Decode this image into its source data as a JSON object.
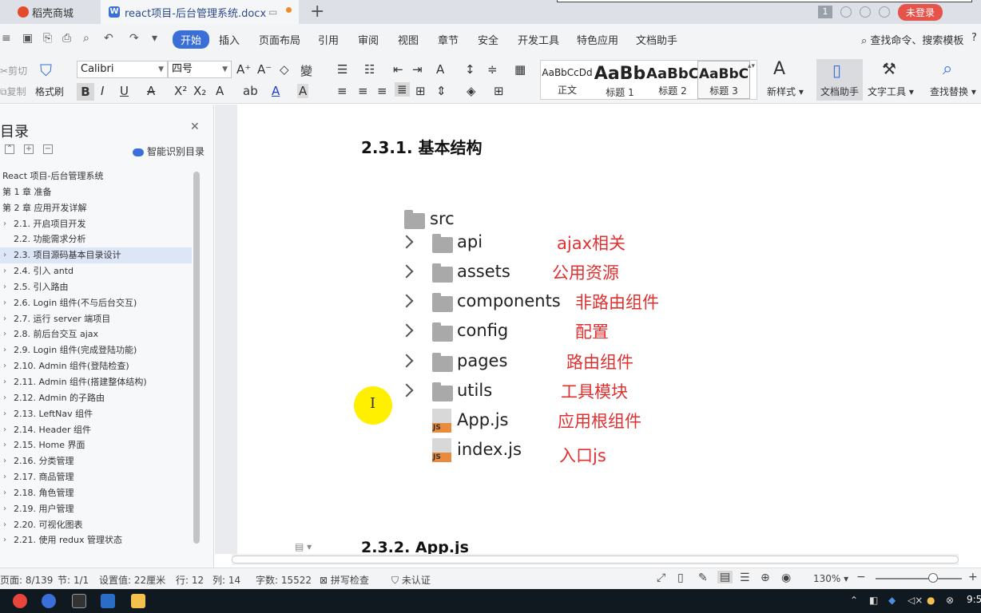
{
  "titlebar": {
    "tab_shop": "稻壳商城",
    "tab_doc": "react项目-后台管理系统.docx",
    "add_tab": "+",
    "badge": "1",
    "login": "未登录"
  },
  "menu": {
    "items": [
      "开始",
      "插入",
      "页面布局",
      "引用",
      "审阅",
      "视图",
      "章节",
      "安全",
      "开发工具",
      "特色应用",
      "文档助手"
    ],
    "search": "查找命令、搜索模板",
    "help": "?"
  },
  "ribbon": {
    "cut": "剪切",
    "copy": "复制",
    "format_painter": "格式刷",
    "font_name": "Calibri",
    "font_size": "四号",
    "styles": [
      {
        "preview": "AaBbCcDd",
        "name": "正文"
      },
      {
        "preview": "AaBb",
        "name": "标题 1"
      },
      {
        "preview": "AaBbC",
        "name": "标题 2"
      },
      {
        "preview": "AaBbC",
        "name": "标题 3"
      }
    ],
    "new_style": "新样式",
    "doc_helper": "文档助手",
    "text_tools": "文字工具",
    "find_replace": "查找替换"
  },
  "nav": {
    "title": "目录",
    "smart": "智能识别目录",
    "items": [
      {
        "text": "React 项目-后台管理系统",
        "level": 0
      },
      {
        "text": "第 1 章  准备",
        "level": 0
      },
      {
        "text": "第 2 章  应用开发详解",
        "level": 0
      },
      {
        "text": "2.1.  开启项目开发",
        "level": 1,
        "chev": true
      },
      {
        "text": "2.2.  功能需求分析",
        "level": 1
      },
      {
        "text": "2.3.  项目源码基本目录设计",
        "level": 1,
        "chev": true,
        "active": true
      },
      {
        "text": "2.4.  引入 antd",
        "level": 1,
        "chev": true
      },
      {
        "text": "2.5.  引入路由",
        "level": 1,
        "chev": true
      },
      {
        "text": "2.6. Login 组件(不与后台交互)",
        "level": 1,
        "chev": true
      },
      {
        "text": "2.7.  运行 server 端项目",
        "level": 1,
        "chev": true
      },
      {
        "text": "2.8.  前后台交互 ajax",
        "level": 1,
        "chev": true
      },
      {
        "text": "2.9. Login 组件(完成登陆功能)",
        "level": 1,
        "chev": true
      },
      {
        "text": "2.10. Admin 组件(登陆检查)",
        "level": 1,
        "chev": true
      },
      {
        "text": "2.11. Admin 组件(搭建整体结构)",
        "level": 1,
        "chev": true
      },
      {
        "text": "2.12. Admin 的子路由",
        "level": 1,
        "chev": true
      },
      {
        "text": "2.13. LeftNav 组件",
        "level": 1,
        "chev": true
      },
      {
        "text": "2.14. Header 组件",
        "level": 1,
        "chev": true
      },
      {
        "text": "2.15. Home 界面",
        "level": 1,
        "chev": true
      },
      {
        "text": "2.16.  分类管理",
        "level": 1,
        "chev": true
      },
      {
        "text": "2.17.  商品管理",
        "level": 1,
        "chev": true
      },
      {
        "text": "2.18.  角色管理",
        "level": 1,
        "chev": true
      },
      {
        "text": "2.19.  用户管理",
        "level": 1,
        "chev": true
      },
      {
        "text": "2.20.  可视化图表",
        "level": 1,
        "chev": true
      },
      {
        "text": "2.21.  使用 redux 管理状态",
        "level": 1,
        "chev": true
      }
    ]
  },
  "doc": {
    "heading1": "2.3.1.  基本结构",
    "heading2": "2.3.2. App.js",
    "root": "src",
    "tree": [
      {
        "name": "api",
        "kind": "folder",
        "note": "ajax相关"
      },
      {
        "name": "assets",
        "kind": "folder",
        "note": "公用资源"
      },
      {
        "name": "components",
        "kind": "folder",
        "note": "非路由组件"
      },
      {
        "name": "config",
        "kind": "folder",
        "note": "配置"
      },
      {
        "name": "pages",
        "kind": "folder",
        "note": "路由组件"
      },
      {
        "name": "utils",
        "kind": "folder",
        "note": "工具模块"
      },
      {
        "name": "App.js",
        "kind": "js",
        "note": "应用根组件"
      },
      {
        "name": "index.js",
        "kind": "js",
        "note": "入口js"
      }
    ],
    "js_badge": "JS"
  },
  "status": {
    "page": "页面: 8/139",
    "section": "节: 1/1",
    "setting": "设置值: 22厘米",
    "row": "行: 12",
    "col": "列: 14",
    "words": "字数: 15522",
    "spell": "拼写检查",
    "cert": "未认证",
    "zoom": "130%"
  },
  "taskbar": {
    "clock": "9:5"
  },
  "colors": {
    "accent": "#3b6fd8",
    "annotation": "#e03030",
    "login": "#e5534b",
    "highlight": "#fff000"
  }
}
